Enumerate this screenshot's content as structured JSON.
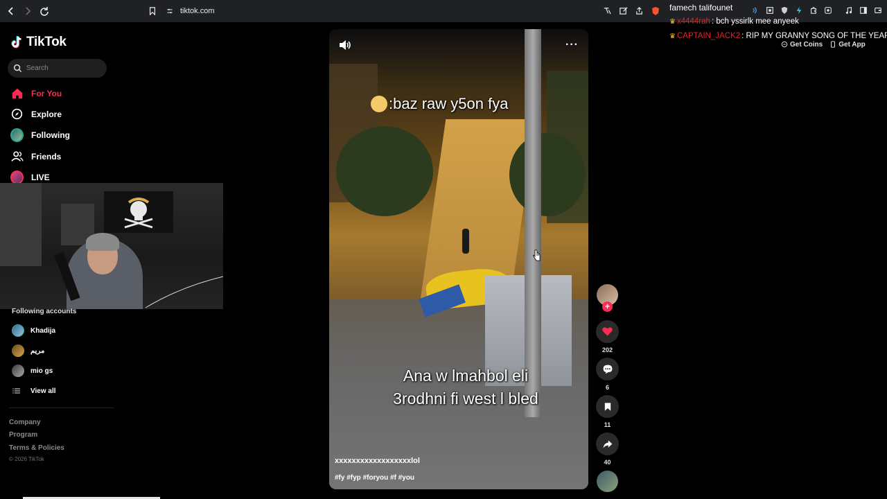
{
  "browser": {
    "url": "tiktok.com"
  },
  "sidebar": {
    "logo": "TikTok",
    "search_placeholder": "Search",
    "menu": [
      {
        "label": "For You",
        "icon": "home-icon"
      },
      {
        "label": "Explore",
        "icon": "compass-icon"
      },
      {
        "label": "Following",
        "icon": "following-avatar"
      },
      {
        "label": "Friends",
        "icon": "friends-icon"
      },
      {
        "label": "LIVE",
        "icon": "live-avatar"
      }
    ],
    "following_title": "Following accounts",
    "accounts": [
      {
        "name": "Khadija"
      },
      {
        "name": "مريم"
      },
      {
        "name": "mio gs"
      }
    ],
    "view_all": "View all",
    "footer": [
      "Company",
      "Program",
      "Terms & Policies"
    ],
    "copyright": "© 2026 TikTok"
  },
  "video": {
    "caption_top": ":baz raw y5on fya",
    "caption_bottom_line1": "Ana w lmahbol eli",
    "caption_bottom_line2": "3rodhni fi west l bled",
    "username": "xxxxxxxxxxxxxxxxxxlol",
    "hashtags": "#fy #fyp #foryou #f #you"
  },
  "actions": {
    "likes": "202",
    "comments": "6",
    "saves": "11",
    "shares": "40"
  },
  "chat": [
    {
      "name": "",
      "text": "famech talifounet"
    },
    {
      "name": "x4444rah",
      "text": ": bch yssirlk mee anyeek"
    },
    {
      "name": "CAPTAIN_JACK2",
      "text": ": RIP MY GRANNY SONG OF THE YEAR"
    }
  ],
  "topbar": {
    "get_coins": "Get Coins",
    "get_app": "Get App"
  },
  "colors": {
    "accent": "#fe2c55",
    "background": "#000000"
  }
}
